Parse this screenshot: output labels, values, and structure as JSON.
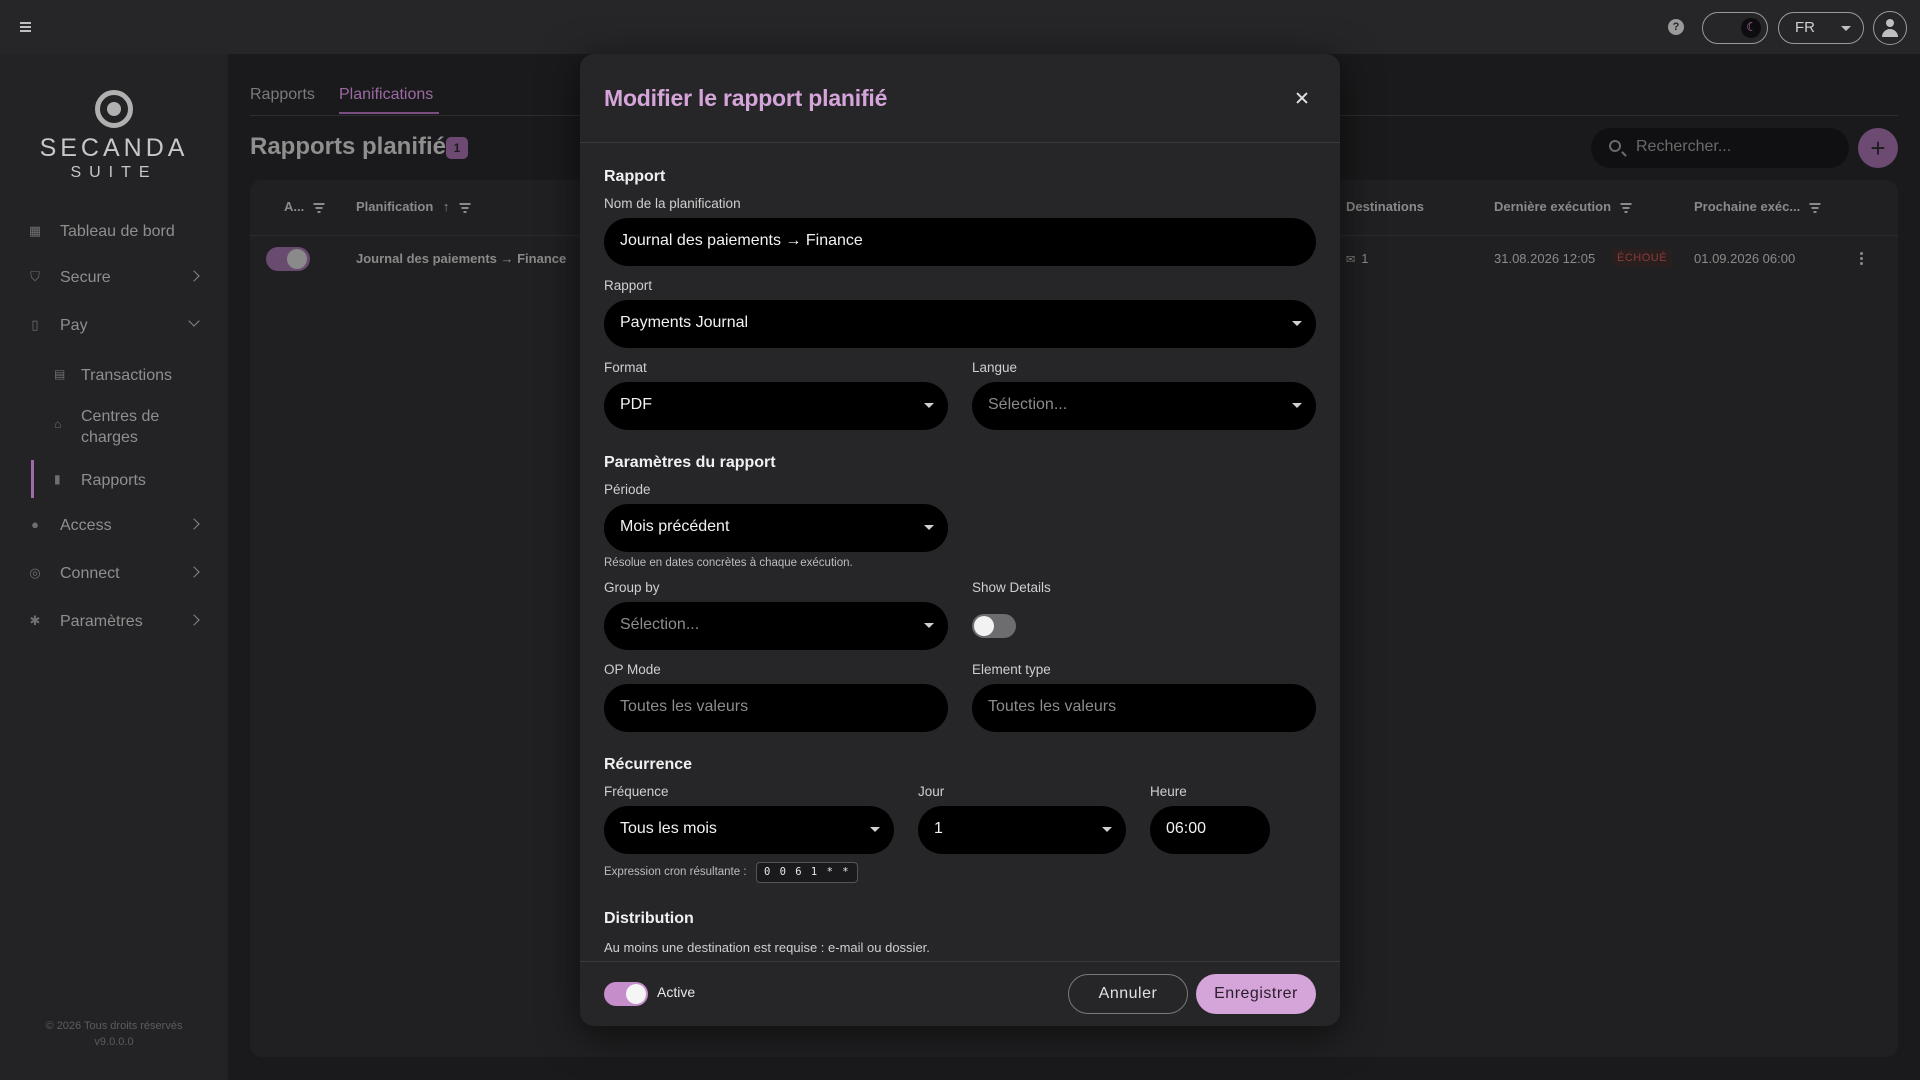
{
  "topbar": {
    "lang": "FR"
  },
  "brand": {
    "name": "SECANDA",
    "sub": "SUITE"
  },
  "sidebar": {
    "items": [
      {
        "label": "Tableau de bord"
      },
      {
        "label": "Secure"
      },
      {
        "label": "Pay"
      },
      {
        "label": "Access"
      },
      {
        "label": "Connect"
      },
      {
        "label": "Paramètres"
      }
    ],
    "pay_sub": [
      {
        "label": "Transactions"
      },
      {
        "label": "Centres de charges"
      },
      {
        "label": "Rapports"
      }
    ],
    "footer_copyright": "© 2026 Tous droits réservés",
    "footer_version": "v9.0.0.0"
  },
  "tabs": {
    "reports": "Rapports",
    "schedules": "Planifications"
  },
  "page": {
    "title": "Rapports planifiés",
    "count": "1"
  },
  "search": {
    "placeholder": "Rechercher..."
  },
  "table": {
    "headers": {
      "active": "A...",
      "schedule": "Planification",
      "sort_arrow": "↑",
      "destinations": "Destinations",
      "last_run": "Dernière exécution",
      "next_run": "Prochaine exéc..."
    },
    "rows": [
      {
        "name": "Journal des paiements → Finance",
        "destinations": "1",
        "last_run": "31.08.2026 12:05",
        "status": "ÉCHOUÉ",
        "next_run": "01.09.2026 06:00"
      }
    ]
  },
  "modal": {
    "title": "Modifier le rapport planifié",
    "sections": {
      "report": "Rapport",
      "params": "Paramètres du rapport",
      "recurrence": "Récurrence",
      "distribution": "Distribution"
    },
    "fields": {
      "schedule_name": {
        "label": "Nom de la planification",
        "value": "Journal des paiements → Finance"
      },
      "report": {
        "label": "Rapport",
        "value": "Payments Journal"
      },
      "format": {
        "label": "Format",
        "value": "PDF"
      },
      "language": {
        "label": "Langue",
        "placeholder": "Sélection..."
      },
      "period": {
        "label": "Période",
        "value": "Mois précédent",
        "hint": "Résolue en dates concrètes à chaque exécution."
      },
      "group_by": {
        "label": "Group by",
        "placeholder": "Sélection..."
      },
      "show_details": {
        "label": "Show Details",
        "on": false
      },
      "op_mode": {
        "label": "OP Mode",
        "placeholder": "Toutes les valeurs"
      },
      "element_type": {
        "label": "Element type",
        "placeholder": "Toutes les valeurs"
      },
      "frequency": {
        "label": "Fréquence",
        "value": "Tous les mois"
      },
      "day": {
        "label": "Jour",
        "value": "1"
      },
      "hour": {
        "label": "Heure",
        "value": "06:00"
      }
    },
    "cron_label": "Expression cron résultante :",
    "cron_value": "0 0 6 1 * *",
    "distribution_hint": "Au moins une destination est requise : e-mail ou dossier.",
    "footer": {
      "active_label": "Active",
      "active_on": true,
      "cancel": "Annuler",
      "save": "Enregistrer"
    }
  },
  "colors": {
    "accent": "#d5a5d9",
    "accent_dim": "#6d4a72",
    "error": "#8b3a3a"
  }
}
